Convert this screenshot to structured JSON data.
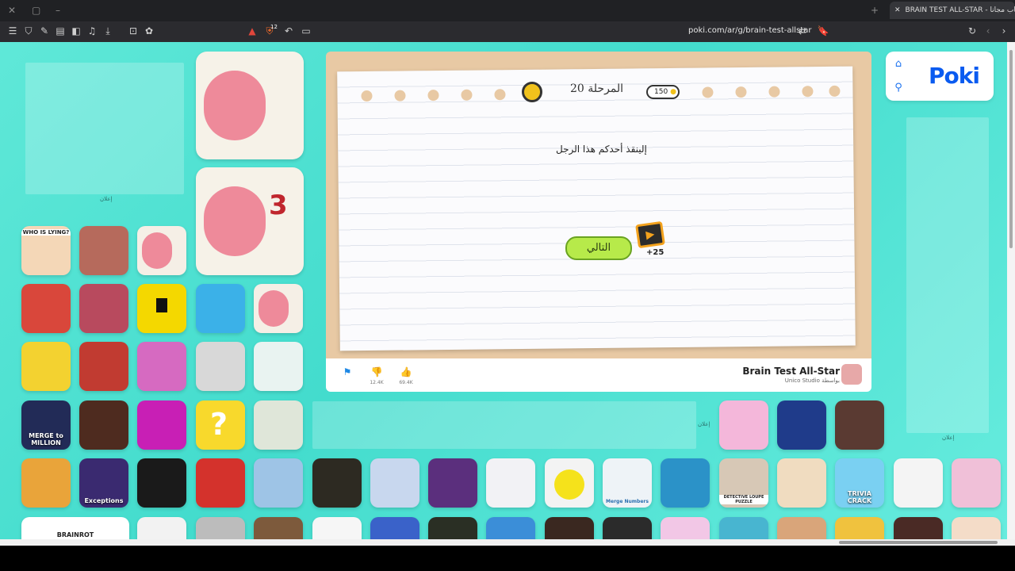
{
  "browser": {
    "tab_title": "BRAIN TEST ALL-STAR - ألعاب مجانا",
    "url": "poki.com/ar/g/brain-test-allstar",
    "shield_badge": "12"
  },
  "game": {
    "level_label": "المرحلة 20",
    "hint_count": "150",
    "question": "إلينقذ أحدكم هذا الرجل",
    "next_button": "التالي",
    "reward": "+25"
  },
  "info": {
    "title": "Brain Test All-Star",
    "by": "Unico Studio بواسطة",
    "dislikes": "12.4K",
    "likes": "69.4K"
  },
  "ads": {
    "label": "إعلان"
  },
  "tiles": {
    "who_is_lying": "WHO IS LYING?",
    "merge_million": "MERGE to MILLION",
    "exceptions": "Exceptions",
    "trivia_crack": "TRIVIA CRACK",
    "detective": "DETECTIVE LOUPE PUZZLE",
    "brainrot": "BRAINROT",
    "merge_numbers": "Merge Numbers"
  },
  "colors": {
    "page_bg": "#43dccd",
    "poki_blue": "#0a5bf0",
    "next_button": "#b7ea4a"
  }
}
